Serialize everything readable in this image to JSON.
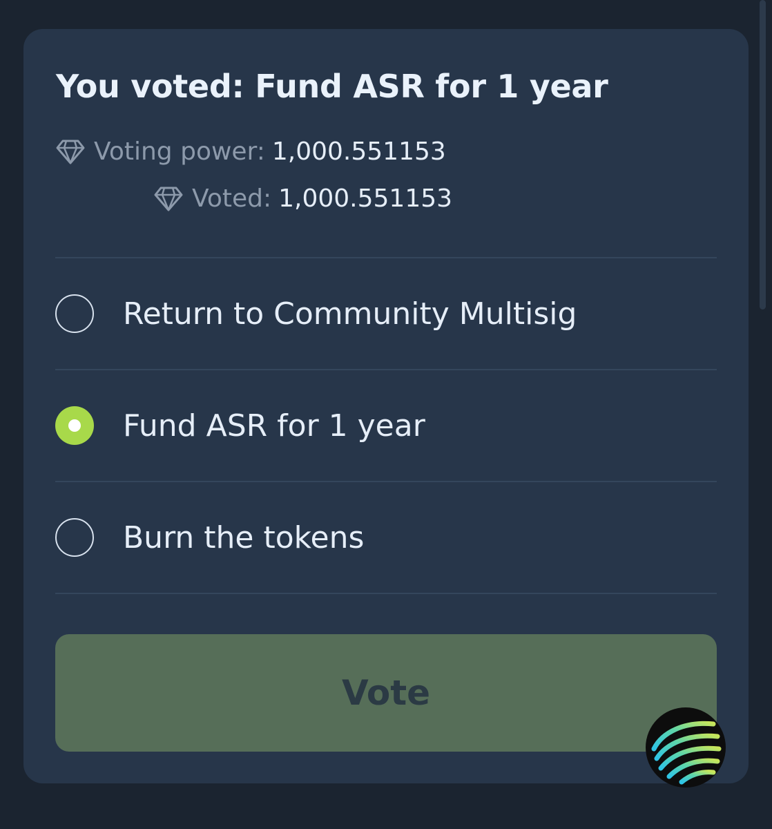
{
  "poll": {
    "title": "You voted: Fund ASR for 1 year",
    "voting_power_label": "Voting power:",
    "voting_power_value": "1,000.551153",
    "voted_label": "Voted:",
    "voted_value": "1,000.551153",
    "stat_icon": "gem-icon",
    "options": [
      {
        "label": "Return to Community Multisig",
        "selected": false
      },
      {
        "label": "Fund ASR for 1 year",
        "selected": true
      },
      {
        "label": "Burn the tokens",
        "selected": false
      }
    ],
    "vote_button_label": "Vote"
  },
  "colors": {
    "background": "#1b2430",
    "card": "#27364a",
    "selected_radio": "#a8d94a",
    "vote_button": "#566e58",
    "vote_button_text": "#2b3a44"
  },
  "floating_button": {
    "icon": "rainbow-arcs-logo-icon"
  }
}
